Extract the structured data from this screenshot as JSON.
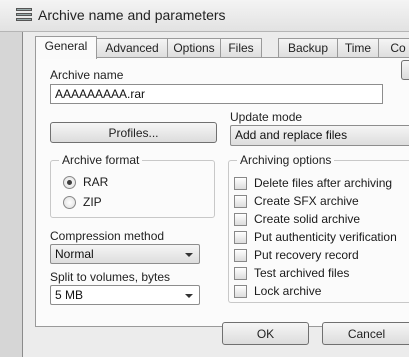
{
  "window": {
    "title": "Archive name and parameters"
  },
  "tabs": [
    {
      "label": "General",
      "active": true
    },
    {
      "label": "Advanced"
    },
    {
      "label": "Options"
    },
    {
      "label": "Files"
    },
    {
      "label": "Backup"
    },
    {
      "label": "Time"
    },
    {
      "label": "Co"
    }
  ],
  "general": {
    "archive_name_label": "Archive name",
    "archive_name_value": "AAAAAAAAA.rar",
    "profiles_button": "Profiles...",
    "update_mode_label": "Update mode",
    "update_mode_value": "Add and replace files",
    "archive_format": {
      "title": "Archive format",
      "options": [
        {
          "label": "RAR",
          "checked": true
        },
        {
          "label": "ZIP",
          "checked": false
        }
      ]
    },
    "compression_label": "Compression method",
    "compression_value": "Normal",
    "split_label": "Split to volumes, bytes",
    "split_value": "5 MB",
    "archiving_options": {
      "title": "Archiving options",
      "items": [
        {
          "label": "Delete files after archiving",
          "checked": false
        },
        {
          "label": "Create SFX archive",
          "checked": false
        },
        {
          "label": "Create solid archive",
          "checked": false
        },
        {
          "label": "Put authenticity verification",
          "checked": false
        },
        {
          "label": "Put recovery record",
          "checked": false
        },
        {
          "label": "Test archived files",
          "checked": false
        },
        {
          "label": "Lock archive",
          "checked": false
        }
      ]
    }
  },
  "footer": {
    "ok": "OK",
    "cancel": "Cancel"
  }
}
